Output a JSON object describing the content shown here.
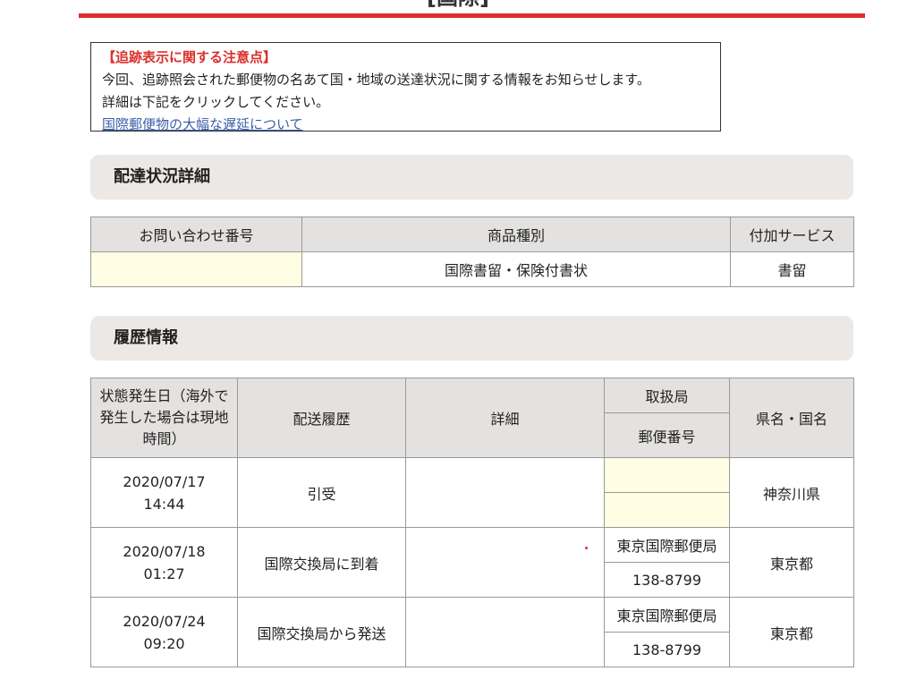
{
  "page": {
    "title": "[国際]",
    "accent_color": "#d9302c"
  },
  "notice": {
    "title": "【追跡表示に関する注意点】",
    "line1": "今回、追跡照会された郵便物の名あて国・地域の送達状況に関する情報をお知らせします。",
    "line2": "詳細は下記をクリックしてください。",
    "link": "国際郵便物の大幅な遅延について"
  },
  "delivery": {
    "section_title": "配達状況詳細",
    "headers": {
      "inquiry_no": "お問い合わせ番号",
      "product_type": "商品種別",
      "extra_service": "付加サービス"
    },
    "row": {
      "inquiry_no": "",
      "product_type": "国際書留・保険付書状",
      "extra_service": "書留"
    }
  },
  "history": {
    "section_title": "履歴情報",
    "headers": {
      "date": "状態発生日（海外で発生した場合は現地時間）",
      "status": "配送履歴",
      "detail": "詳細",
      "office": "取扱局",
      "postal_code": "郵便番号",
      "region": "県名・国名"
    },
    "rows": [
      {
        "date": "2020/07/17",
        "time": "14:44",
        "status": "引受",
        "detail": "",
        "office": "",
        "postal_code": "",
        "region": "神奈川県"
      },
      {
        "date": "2020/07/18",
        "time": "01:27",
        "status": "国際交換局に到着",
        "detail": "",
        "office": "東京国際郵便局",
        "postal_code": "138-8799",
        "region": "東京都"
      },
      {
        "date": "2020/07/24",
        "time": "09:20",
        "status": "国際交換局から発送",
        "detail": "",
        "office": "東京国際郵便局",
        "postal_code": "138-8799",
        "region": "東京都"
      }
    ]
  }
}
